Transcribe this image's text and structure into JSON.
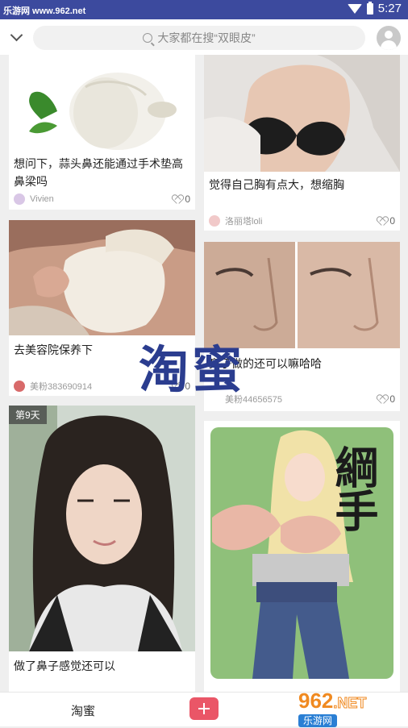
{
  "status_bar": {
    "watermark": "乐游网 www.962.net",
    "time": "5:27"
  },
  "search": {
    "placeholder": "大家都在搜“双眼皮”"
  },
  "posts": [
    {
      "title": "想问下，蒜头鼻还能通过手术垫高鼻梁吗",
      "user": "Vivien",
      "likes": "0"
    },
    {
      "title": "觉得自己胸有点大，想缩胸",
      "user": "洛丽塔loli",
      "likes": "0"
    },
    {
      "title": "去美容院保养下",
      "user": "美粉383690914",
      "likes": "0"
    },
    {
      "title": "鼻子做的还可以嘛哈哈",
      "user": "美粉44656575",
      "likes": "0"
    },
    {
      "badge": "第9天",
      "title": "做了鼻子感觉还可以"
    },
    {
      "art_text": "綱手"
    }
  ],
  "overlay": "淘蜜",
  "bottom_nav": {
    "tab": "淘蜜"
  },
  "logo": {
    "num": "962",
    "tld": ".NET",
    "site": "乐游网"
  }
}
